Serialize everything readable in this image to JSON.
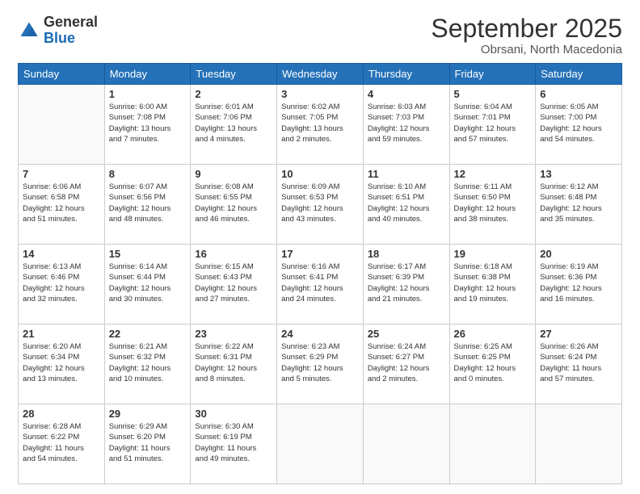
{
  "header": {
    "logo_general": "General",
    "logo_blue": "Blue",
    "month_title": "September 2025",
    "location": "Obrsani, North Macedonia"
  },
  "days_of_week": [
    "Sunday",
    "Monday",
    "Tuesday",
    "Wednesday",
    "Thursday",
    "Friday",
    "Saturday"
  ],
  "weeks": [
    [
      {
        "day": "",
        "info": ""
      },
      {
        "day": "1",
        "info": "Sunrise: 6:00 AM\nSunset: 7:08 PM\nDaylight: 13 hours\nand 7 minutes."
      },
      {
        "day": "2",
        "info": "Sunrise: 6:01 AM\nSunset: 7:06 PM\nDaylight: 13 hours\nand 4 minutes."
      },
      {
        "day": "3",
        "info": "Sunrise: 6:02 AM\nSunset: 7:05 PM\nDaylight: 13 hours\nand 2 minutes."
      },
      {
        "day": "4",
        "info": "Sunrise: 6:03 AM\nSunset: 7:03 PM\nDaylight: 12 hours\nand 59 minutes."
      },
      {
        "day": "5",
        "info": "Sunrise: 6:04 AM\nSunset: 7:01 PM\nDaylight: 12 hours\nand 57 minutes."
      },
      {
        "day": "6",
        "info": "Sunrise: 6:05 AM\nSunset: 7:00 PM\nDaylight: 12 hours\nand 54 minutes."
      }
    ],
    [
      {
        "day": "7",
        "info": "Sunrise: 6:06 AM\nSunset: 6:58 PM\nDaylight: 12 hours\nand 51 minutes."
      },
      {
        "day": "8",
        "info": "Sunrise: 6:07 AM\nSunset: 6:56 PM\nDaylight: 12 hours\nand 48 minutes."
      },
      {
        "day": "9",
        "info": "Sunrise: 6:08 AM\nSunset: 6:55 PM\nDaylight: 12 hours\nand 46 minutes."
      },
      {
        "day": "10",
        "info": "Sunrise: 6:09 AM\nSunset: 6:53 PM\nDaylight: 12 hours\nand 43 minutes."
      },
      {
        "day": "11",
        "info": "Sunrise: 6:10 AM\nSunset: 6:51 PM\nDaylight: 12 hours\nand 40 minutes."
      },
      {
        "day": "12",
        "info": "Sunrise: 6:11 AM\nSunset: 6:50 PM\nDaylight: 12 hours\nand 38 minutes."
      },
      {
        "day": "13",
        "info": "Sunrise: 6:12 AM\nSunset: 6:48 PM\nDaylight: 12 hours\nand 35 minutes."
      }
    ],
    [
      {
        "day": "14",
        "info": "Sunrise: 6:13 AM\nSunset: 6:46 PM\nDaylight: 12 hours\nand 32 minutes."
      },
      {
        "day": "15",
        "info": "Sunrise: 6:14 AM\nSunset: 6:44 PM\nDaylight: 12 hours\nand 30 minutes."
      },
      {
        "day": "16",
        "info": "Sunrise: 6:15 AM\nSunset: 6:43 PM\nDaylight: 12 hours\nand 27 minutes."
      },
      {
        "day": "17",
        "info": "Sunrise: 6:16 AM\nSunset: 6:41 PM\nDaylight: 12 hours\nand 24 minutes."
      },
      {
        "day": "18",
        "info": "Sunrise: 6:17 AM\nSunset: 6:39 PM\nDaylight: 12 hours\nand 21 minutes."
      },
      {
        "day": "19",
        "info": "Sunrise: 6:18 AM\nSunset: 6:38 PM\nDaylight: 12 hours\nand 19 minutes."
      },
      {
        "day": "20",
        "info": "Sunrise: 6:19 AM\nSunset: 6:36 PM\nDaylight: 12 hours\nand 16 minutes."
      }
    ],
    [
      {
        "day": "21",
        "info": "Sunrise: 6:20 AM\nSunset: 6:34 PM\nDaylight: 12 hours\nand 13 minutes."
      },
      {
        "day": "22",
        "info": "Sunrise: 6:21 AM\nSunset: 6:32 PM\nDaylight: 12 hours\nand 10 minutes."
      },
      {
        "day": "23",
        "info": "Sunrise: 6:22 AM\nSunset: 6:31 PM\nDaylight: 12 hours\nand 8 minutes."
      },
      {
        "day": "24",
        "info": "Sunrise: 6:23 AM\nSunset: 6:29 PM\nDaylight: 12 hours\nand 5 minutes."
      },
      {
        "day": "25",
        "info": "Sunrise: 6:24 AM\nSunset: 6:27 PM\nDaylight: 12 hours\nand 2 minutes."
      },
      {
        "day": "26",
        "info": "Sunrise: 6:25 AM\nSunset: 6:25 PM\nDaylight: 12 hours\nand 0 minutes."
      },
      {
        "day": "27",
        "info": "Sunrise: 6:26 AM\nSunset: 6:24 PM\nDaylight: 11 hours\nand 57 minutes."
      }
    ],
    [
      {
        "day": "28",
        "info": "Sunrise: 6:28 AM\nSunset: 6:22 PM\nDaylight: 11 hours\nand 54 minutes."
      },
      {
        "day": "29",
        "info": "Sunrise: 6:29 AM\nSunset: 6:20 PM\nDaylight: 11 hours\nand 51 minutes."
      },
      {
        "day": "30",
        "info": "Sunrise: 6:30 AM\nSunset: 6:19 PM\nDaylight: 11 hours\nand 49 minutes."
      },
      {
        "day": "",
        "info": ""
      },
      {
        "day": "",
        "info": ""
      },
      {
        "day": "",
        "info": ""
      },
      {
        "day": "",
        "info": ""
      }
    ]
  ]
}
